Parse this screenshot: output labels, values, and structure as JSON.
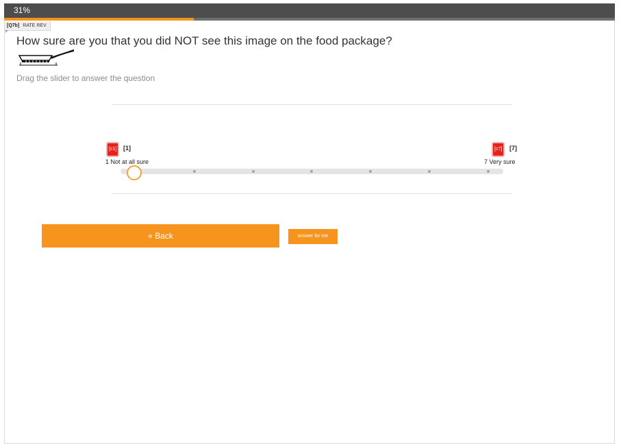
{
  "progress": {
    "label": "31%",
    "value": 0.31,
    "color": "#f7941d"
  },
  "question_tag": {
    "code": "[Q7b]",
    "label": "RATE REV"
  },
  "question": {
    "text": "How sure are you that you did NOT see this image on the food package?",
    "image_icon": "frying-pan-icon"
  },
  "instruction": "Drag the slider to answer the question",
  "scale": {
    "min": {
      "badge": "[c1]",
      "value": "[1]",
      "label": "1 Not at all sure"
    },
    "max": {
      "badge": "[c7]",
      "value": "[7]",
      "label": "7 Very sure"
    },
    "points": 7,
    "selected": 1
  },
  "buttons": {
    "back": "« Back",
    "answer_for_me": "answer for me"
  },
  "colors": {
    "accent": "#f7941d",
    "badge": "#e8221b",
    "header": "#4d4d4d"
  }
}
